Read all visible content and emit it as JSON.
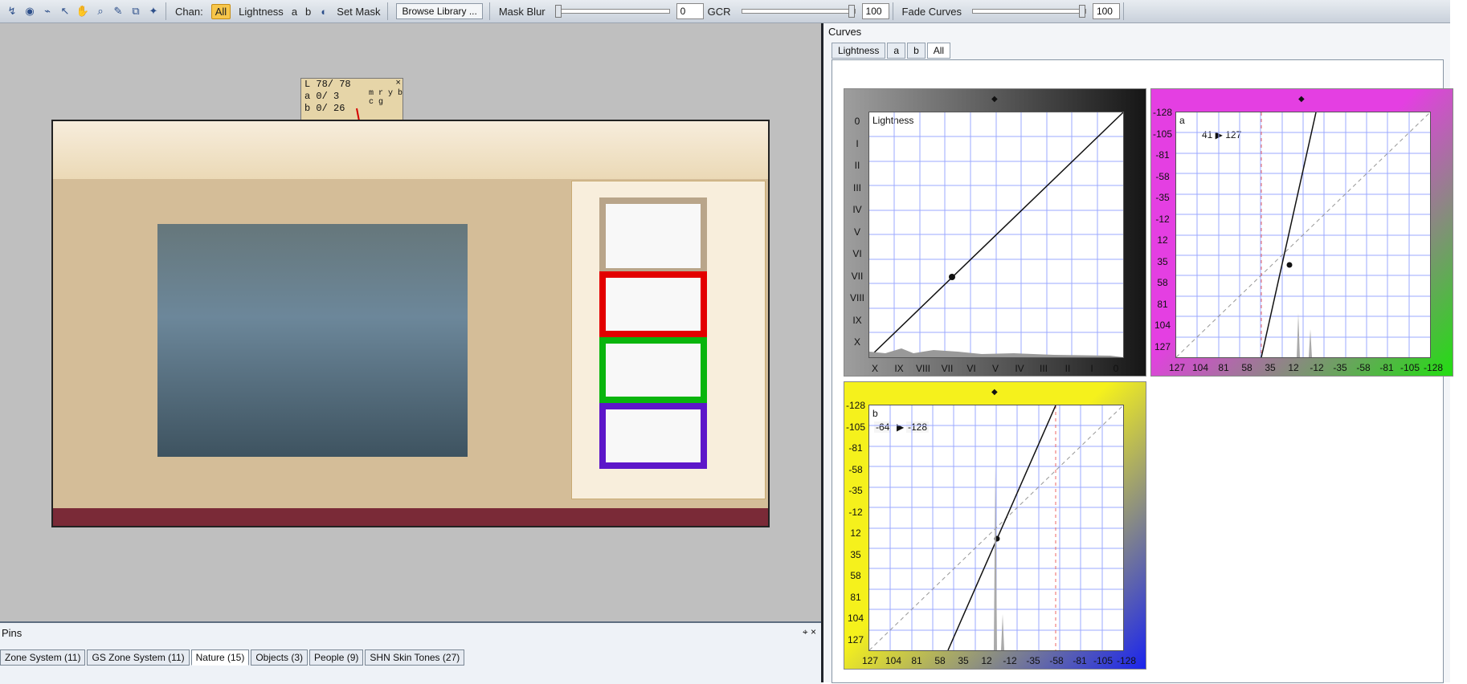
{
  "toolbar": {
    "chan_label": "Chan:",
    "channels": [
      "All",
      "Lightness",
      "a",
      "b"
    ],
    "set_mask": "Set Mask",
    "browse_library": "Browse Library ...",
    "mask_blur_label": "Mask Blur",
    "mask_blur_value": "0",
    "gcr_label": "GCR",
    "gcr_value": "100",
    "fade_curves_label": "Fade Curves",
    "fade_curves_value": "100"
  },
  "probe": {
    "rows": [
      "L 78/ 78",
      "a  0/  3",
      "b  0/ 26"
    ],
    "glyphs": "m r y b c g"
  },
  "pins": {
    "title": "Pins",
    "tabs": [
      "Zone System (11)",
      "GS Zone System (11)",
      "Nature (15)",
      "Objects (3)",
      "People (9)",
      "SHN Skin Tones (27)"
    ],
    "active_tab": "Nature (15)"
  },
  "curves": {
    "title": "Curves",
    "tabs": [
      "Lightness",
      "a",
      "b",
      "All"
    ],
    "active_tab": "All",
    "lightness": {
      "title": "Lightness",
      "zones_y": [
        "0",
        "I",
        "II",
        "III",
        "IV",
        "V",
        "VI",
        "VII",
        "VIII",
        "IX",
        "X"
      ],
      "zones_x": [
        "X",
        "IX",
        "VIII",
        "VII",
        "VI",
        "V",
        "IV",
        "III",
        "II",
        "I",
        "0"
      ]
    },
    "a_panel": {
      "title": "a",
      "readout": "41 ▶ 127",
      "scale_y": [
        "-128",
        "-105",
        "-81",
        "-58",
        "-35",
        "-12",
        "12",
        "35",
        "58",
        "81",
        "104",
        "127"
      ],
      "scale_x": [
        "127",
        "104",
        "81",
        "58",
        "35",
        "12",
        "-12",
        "-35",
        "-58",
        "-81",
        "-105",
        "-128"
      ]
    },
    "b_panel": {
      "title": "b",
      "readout_in": "-64",
      "readout_out": "-128",
      "scale_y": [
        "-128",
        "-105",
        "-81",
        "-58",
        "-35",
        "-12",
        "12",
        "35",
        "58",
        "81",
        "104",
        "127"
      ],
      "scale_x": [
        "127",
        "104",
        "81",
        "58",
        "35",
        "12",
        "-12",
        "-35",
        "-58",
        "-81",
        "-105",
        "-128"
      ]
    }
  },
  "colors": {
    "active": "#f7c64b",
    "magenta": "#e43fe2",
    "yellow": "#f5f11c",
    "blue": "#1a24ee",
    "green": "#22de11"
  }
}
